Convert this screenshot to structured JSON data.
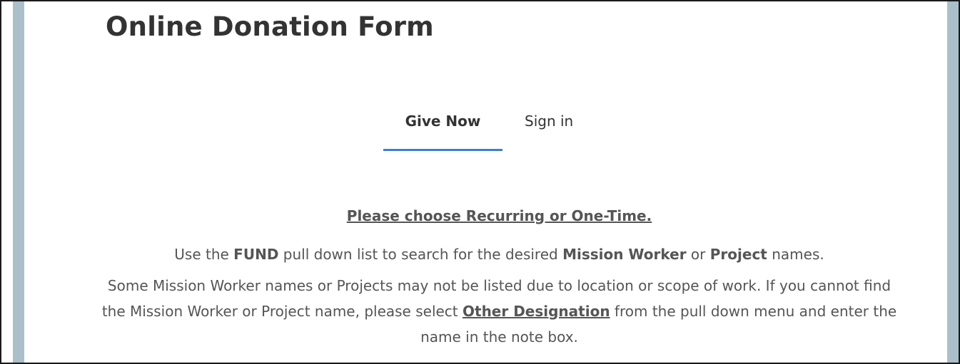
{
  "page": {
    "title": "Online Donation Form"
  },
  "tabs": [
    {
      "label": "Give Now",
      "active": true
    },
    {
      "label": "Sign in",
      "active": false
    }
  ],
  "instructions": {
    "heading": "Please choose Recurring or One-Time.",
    "fund_line": {
      "t1": "Use the ",
      "fund": "FUND",
      "t2": " pull down list to search for the desired ",
      "mission_worker": "Mission Worker",
      "t3": " or ",
      "project": "Project",
      "t4": " names."
    },
    "note_line": {
      "t1": "Some Mission Worker names or Projects may not be listed due to location or scope of work. If you cannot find the Mission Worker or Project name, please select ",
      "link": "Other Designation",
      "t2": " from the pull down menu and enter the name in the note box."
    }
  },
  "colors": {
    "side_bar": "#aabfc9",
    "tab_underline": "#3a7fd5",
    "text": "#555555",
    "title": "#333333"
  }
}
